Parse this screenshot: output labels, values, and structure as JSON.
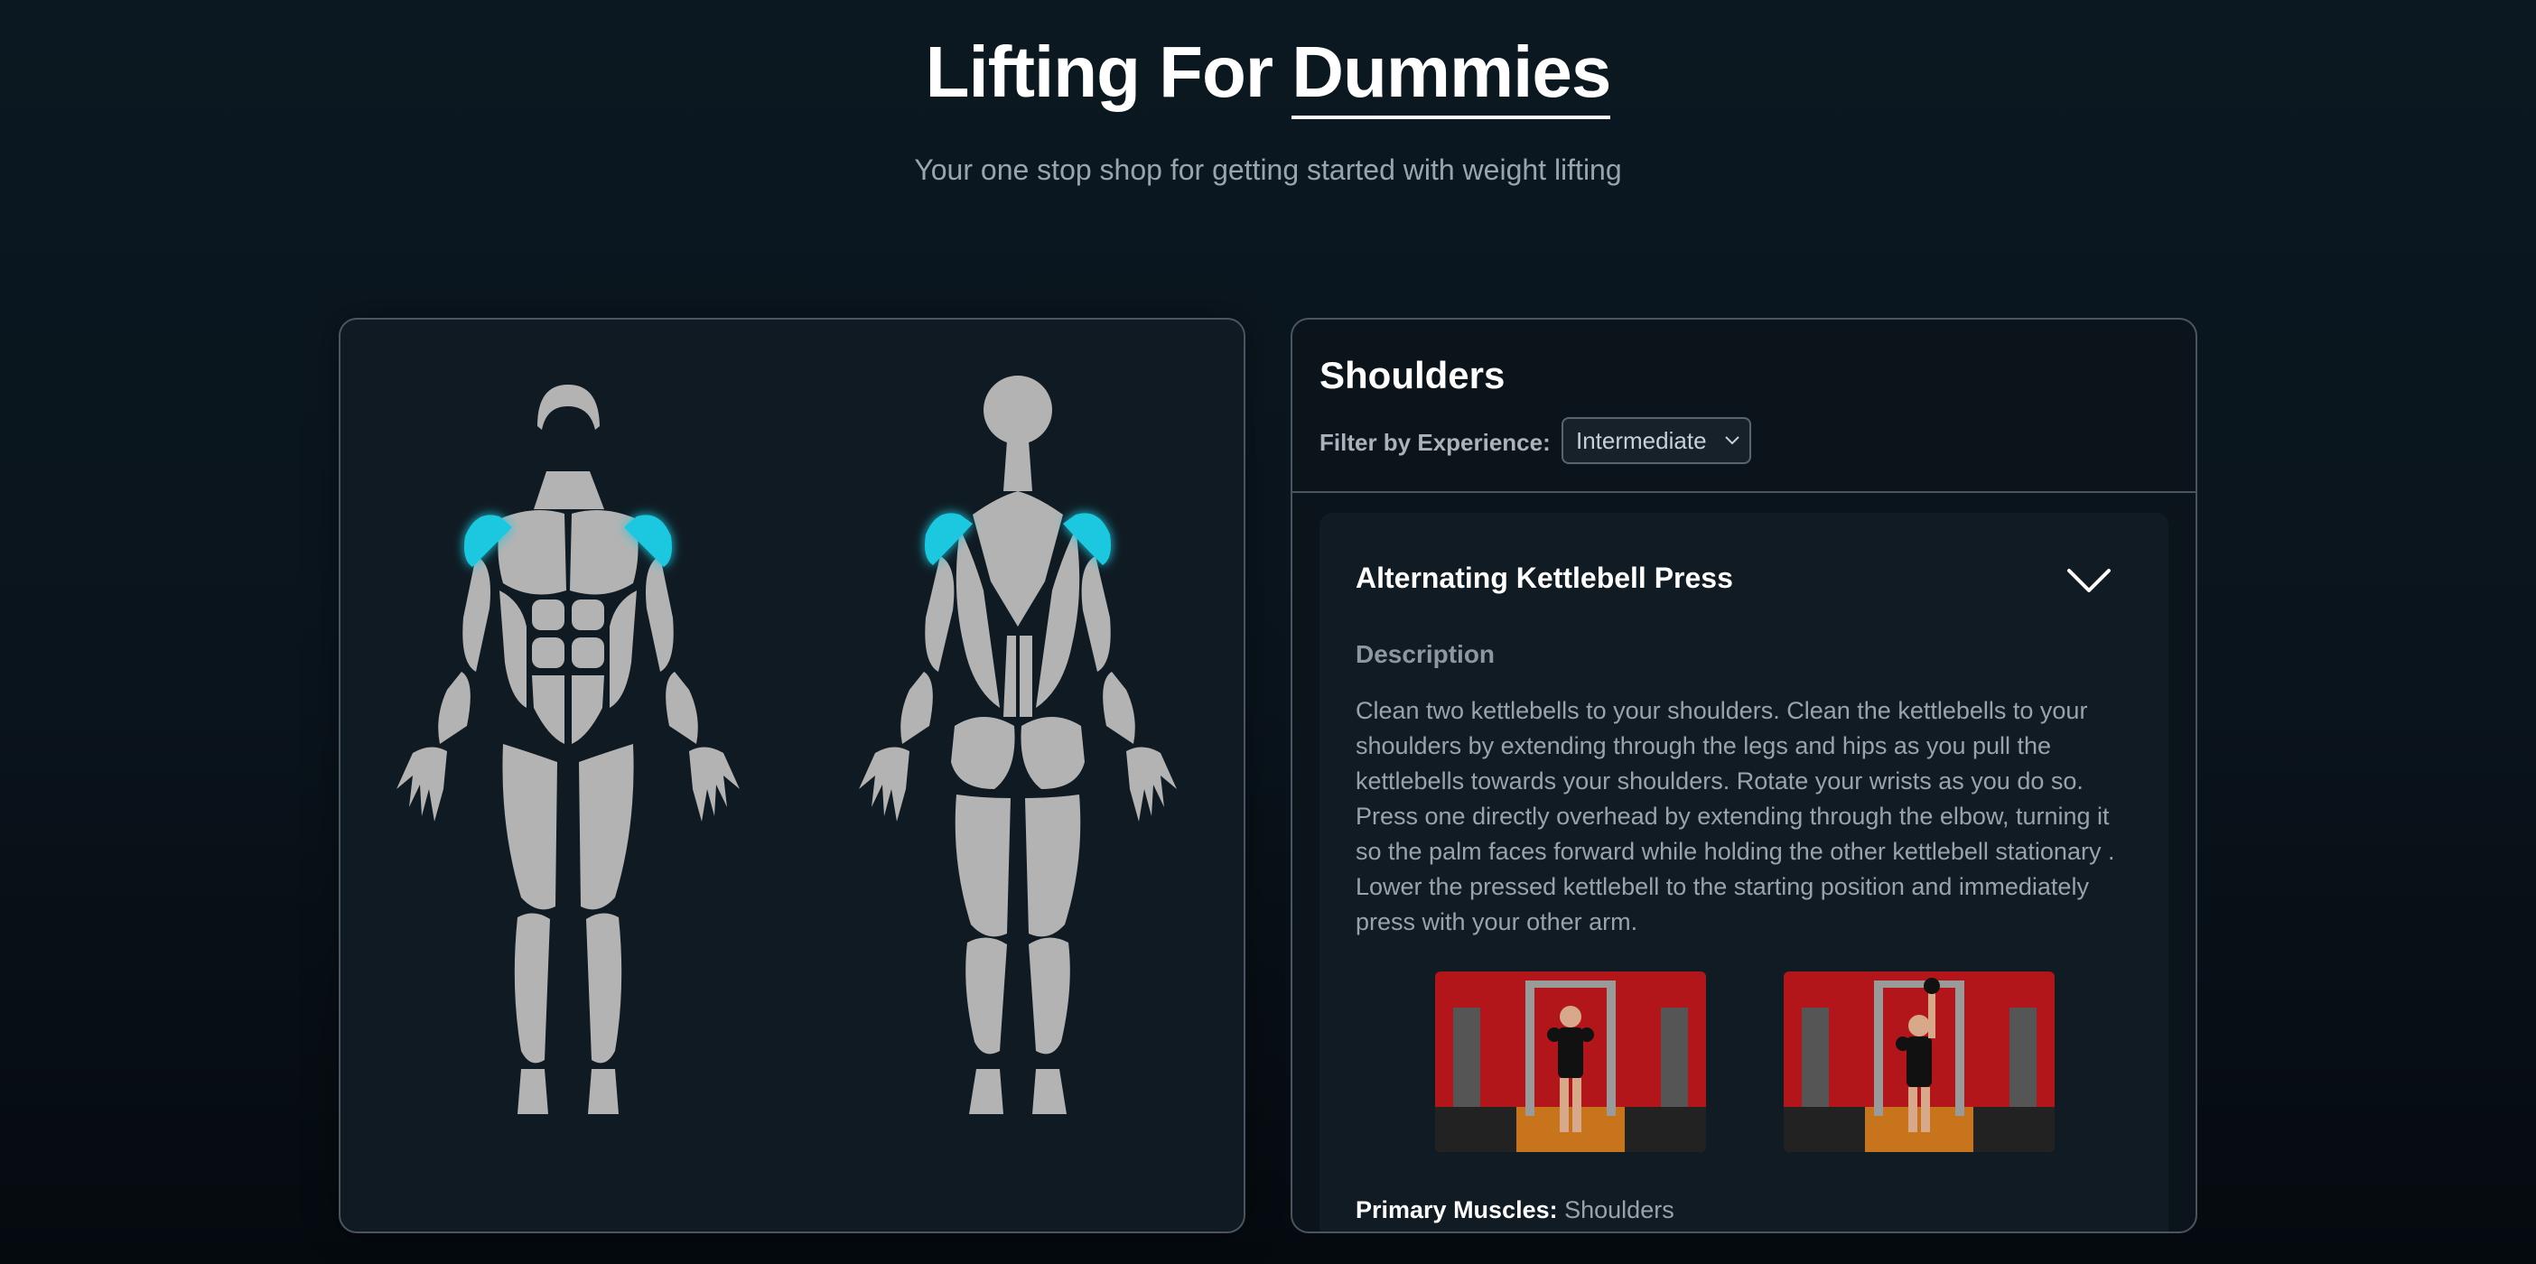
{
  "header": {
    "title_prefix": "Lifting For ",
    "title_emphasis": "Dummies",
    "subtitle": "Your one stop shop for getting started with weight lifting"
  },
  "body_map": {
    "highlighted_muscle": "Shoulders",
    "highlight_color": "#1fc8e0",
    "muscle_color": "#b3b3b3"
  },
  "detail": {
    "muscle_title": "Shoulders",
    "filter_label": "Filter by Experience:",
    "filter_selected": "Intermediate",
    "exercise": {
      "name": "Alternating Kettlebell Press",
      "toggle_icon": "chevron-down-icon",
      "description_heading": "Description",
      "description": "Clean two kettlebells to your shoulders. Clean the kettlebells to your shoulders by extending through the legs and hips as you pull the kettlebells towards your shoulders. Rotate your wrists as you do so. Press one directly overhead by extending through the elbow, turning it so the palm faces forward while holding the other kettlebell stationary . Lower the pressed kettlebell to the starting position and immediately press with your other arm.",
      "primary_label": "Primary Muscles:",
      "primary_value": "Shoulders"
    }
  },
  "colors": {
    "background": "#0b1821",
    "panel_border": "#4a5561",
    "accent": "#1fc8e0",
    "photo_wall": "#b3161a"
  }
}
